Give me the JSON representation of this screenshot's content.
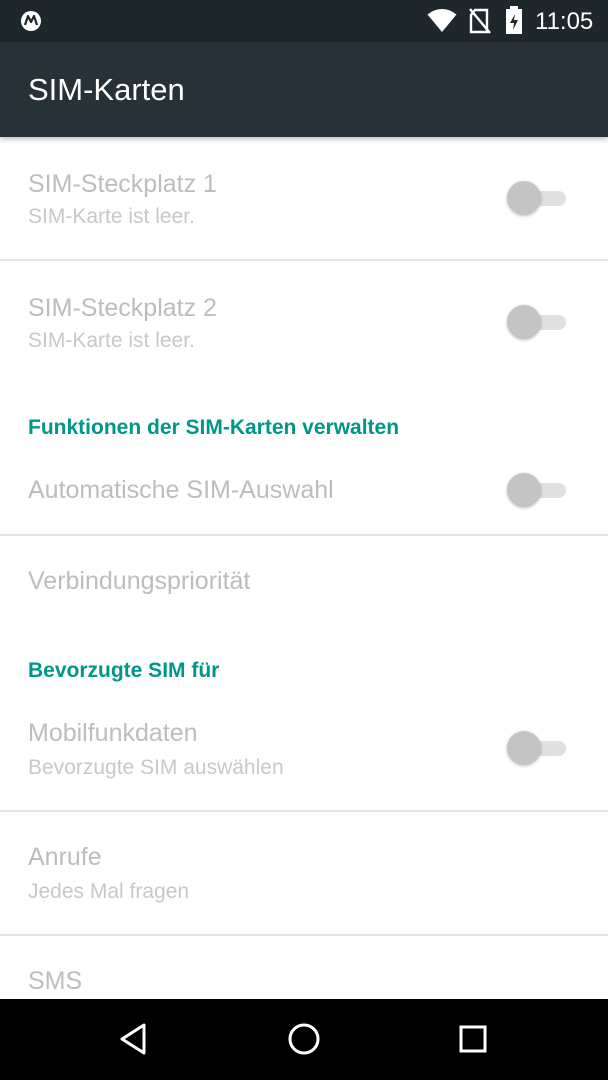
{
  "status_bar": {
    "time": "11:05",
    "icons": [
      "motorola-logo-icon",
      "wifi-icon",
      "no-sim-icon",
      "battery-icon"
    ]
  },
  "app_bar": {
    "title": "SIM-Karten"
  },
  "sim_slots": [
    {
      "title": "SIM-Steckplatz 1",
      "summary": "SIM-Karte ist leer.",
      "toggle_on": false,
      "enabled": false
    },
    {
      "title": "SIM-Steckplatz 2",
      "summary": "SIM-Karte ist leer.",
      "toggle_on": false,
      "enabled": false
    }
  ],
  "manage_section": {
    "header": "Funktionen der SIM-Karten verwalten",
    "auto_select": {
      "title": "Automatische SIM-Auswahl",
      "toggle_on": false,
      "enabled": false
    },
    "connection_priority": {
      "title": "Verbindungspriorität",
      "enabled": false
    }
  },
  "preferred_section": {
    "header": "Bevorzugte SIM für",
    "mobile_data": {
      "title": "Mobilfunkdaten",
      "summary": "Bevorzugte SIM auswählen",
      "toggle_on": false,
      "enabled": false
    },
    "calls": {
      "title": "Anrufe",
      "summary": "Jedes Mal fragen",
      "enabled": false
    },
    "sms": {
      "title": "SMS",
      "enabled": false
    }
  },
  "nav_bar": {
    "buttons": [
      "back-icon",
      "home-icon",
      "recents-icon"
    ]
  },
  "colors": {
    "status_bar": "#1e282c",
    "app_bar": "#263238",
    "accent": "#009688",
    "disabled_text": "#bdbdbd",
    "divider": "#e6e6e6"
  }
}
